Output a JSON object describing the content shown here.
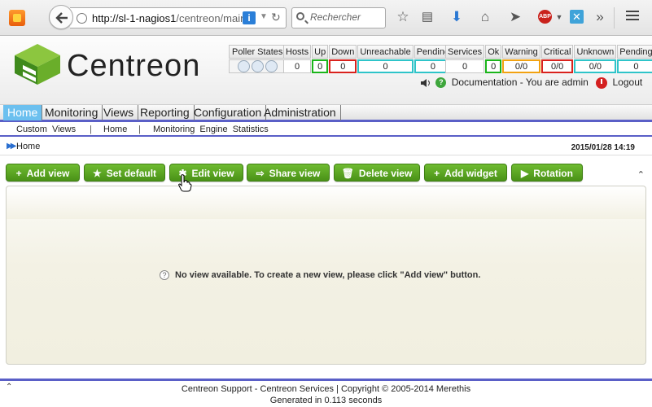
{
  "browser": {
    "url_host": "http://sl-1-nagios1",
    "url_rest": "/centreon/main",
    "search_placeholder": "Recherche",
    "search_value": "Rechercher",
    "abp_label": "ABP",
    "more_label": "»"
  },
  "header": {
    "logo_text": "Centreon",
    "poller_label": "Poller States",
    "hosts": {
      "labels": [
        "Hosts",
        "Up",
        "Down",
        "Unreachable",
        "Pending"
      ],
      "values": [
        "0",
        "0",
        "0",
        "0",
        "0"
      ]
    },
    "services": {
      "labels": [
        "Services",
        "Ok",
        "Warning",
        "Critical",
        "Unknown",
        "Pending"
      ],
      "values": [
        "0",
        "0",
        "0/0",
        "0/0",
        "0/0",
        "0"
      ]
    },
    "documentation_label": "Documentation",
    "admin_label": "- You are admin",
    "logout_label": "Logout"
  },
  "menu": {
    "items": [
      "Home",
      "Monitoring",
      "Views",
      "Reporting",
      "Configuration",
      "Administration"
    ],
    "active": "Home"
  },
  "submenu": {
    "items": [
      "Custom Views",
      "Home",
      "Monitoring Engine Statistics"
    ]
  },
  "breadcrumb": {
    "text": "Home",
    "date": "2015/01/28 14:19"
  },
  "toolbar": {
    "buttons": [
      {
        "label": "Add view",
        "icon": "+"
      },
      {
        "label": "Set default",
        "icon": "★"
      },
      {
        "label": "Edit view",
        "icon": "✱"
      },
      {
        "label": "Share view",
        "icon": "⇨"
      },
      {
        "label": "Delete view",
        "icon": "🗑"
      },
      {
        "label": "Add widget",
        "icon": "+"
      },
      {
        "label": "Rotation",
        "icon": "▶"
      }
    ]
  },
  "main": {
    "empty_message": "No view available. To create a new view, please click \"Add view\" button."
  },
  "footer": {
    "line1": "Centreon Support - Centreon Services | Copyright © 2005-2014 Merethis",
    "line2": "Generated in 0.113 seconds"
  },
  "colors": {
    "accent_blue": "#5a5fc7",
    "active_tab": "#6cc0ef",
    "button_green": "#4a9217",
    "status_green": "#1bb51b",
    "status_red": "#d9221d",
    "status_cyan": "#2ec4c9",
    "status_orange": "#f2a211"
  }
}
